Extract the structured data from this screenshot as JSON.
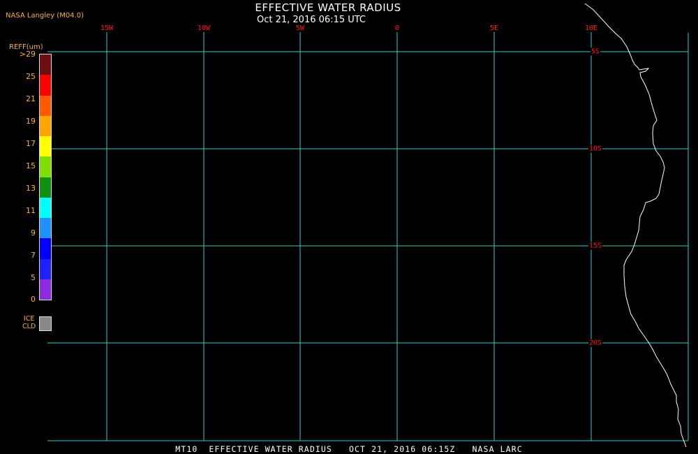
{
  "title": "EFFECTIVE WATER RADIUS",
  "subtitle": "Oct 21, 2016 06:15 UTC",
  "credit": "NASA Langley (M04.0)",
  "footer": "MT10  EFFECTIVE WATER RADIUS   OCT 21, 2016 06:15Z   NASA LARC",
  "map": {
    "lon_labels": [
      "15W",
      "10W",
      "5W",
      "0",
      "5E",
      "10E"
    ],
    "lat_labels": [
      "5S",
      "10S",
      "15S",
      "20S"
    ],
    "grid_color": "#2fd0d0",
    "label_color": "#ff1a1a",
    "coastline_color": "#ffffff"
  },
  "legend": {
    "title": "REFF(um)",
    "ticks": [
      ">29",
      "25",
      "21",
      "19",
      "17",
      "15",
      "13",
      "11",
      "9",
      "7",
      "5",
      "0"
    ],
    "colors": [
      "#6e0f0f",
      "#ff0000",
      "#ff5a00",
      "#ffa500",
      "#ffff00",
      "#7fe000",
      "#109010",
      "#00ffff",
      "#1e90ff",
      "#0000ff",
      "#2020ff",
      "#8a2be2"
    ],
    "ice_label": "ICE\nCLD",
    "ice_color": "#888888"
  }
}
